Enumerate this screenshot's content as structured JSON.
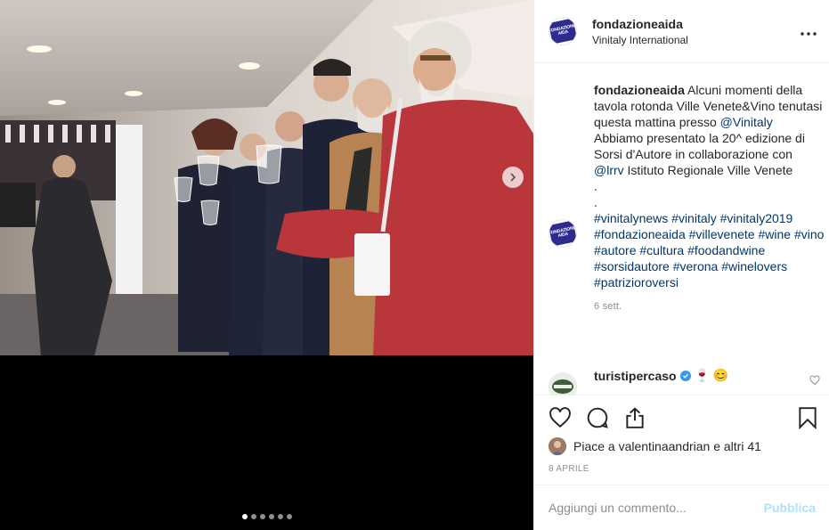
{
  "post": {
    "username": "fondazioneaida",
    "location": "Vinitaly International",
    "logo_text": "FONDAZIONE AIDA",
    "more_icon": "more-horizontal-icon"
  },
  "caption": {
    "username": "fondazioneaida",
    "text_1": " Alcuni momenti della tavola rotonda Ville Venete&Vino tenutasi questa mattina presso ",
    "mention_1": "@Vinitaly",
    "text_2": "\nAbbiamo presentato la 20^ edizione di Sorsi d'Autore in collaborazione con ",
    "mention_2": "@lrrv",
    "text_3": " Istituto Regionale Ville Venete\n.\n.\n",
    "hashtags": "#vinitalynews #vinitaly #vinitaly2019 #fondazioneaida #villevenete #wine #vino #autore #cultura #foodandwine #sorsidautore #verona #winelovers #patrizioroversi",
    "time": "6 sett."
  },
  "comment": {
    "username": "turistipercaso",
    "emoji": "🍷 😊"
  },
  "actions": {
    "likes_text": "Piace a valentinaandrian e altri 41",
    "date": "8 APRILE"
  },
  "add_comment": {
    "placeholder": "Aggiungi un commento...",
    "publish_label": "Pubblica"
  },
  "carousel": {
    "slide_count": 6,
    "active_index": 0
  },
  "colors": {
    "link": "#00376b",
    "publish_disabled": "#b2dffc",
    "logo": "#2b2c8e",
    "verified": "#3897f0"
  }
}
